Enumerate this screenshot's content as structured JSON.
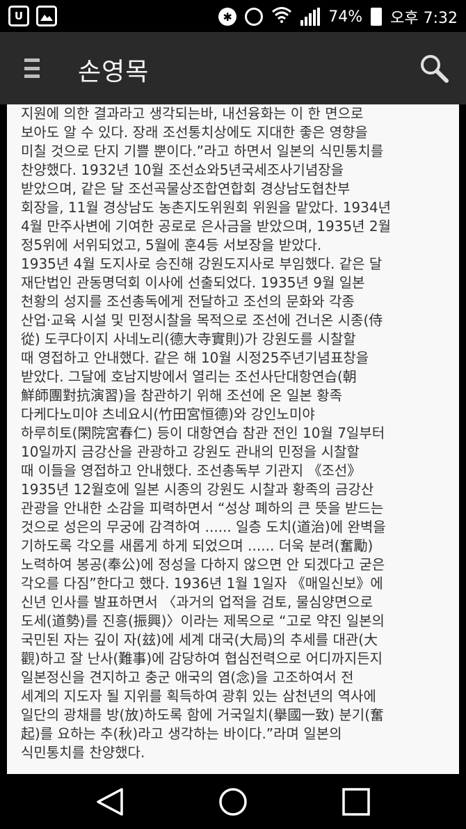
{
  "status_bar": {
    "left_icon_1": "U",
    "battery_percent": "74%",
    "time": "오후 7:32",
    "icons": [
      "uplus-icon",
      "image-icon",
      "bluetooth-icon",
      "alarm-icon",
      "wifi-icon",
      "signal-icon",
      "battery-icon"
    ]
  },
  "app_bar": {
    "title": "손영목"
  },
  "content": {
    "lines": [
      "지원에 의한 결과라고 생각되는바, 내선융화는 이 한 면으로",
      "보아도 알 수 있다. 장래 조선통치상에도 지대한 좋은 영향을",
      "미칠 것으로 단지 기쁠 뿐이다.”라고 하면서 일본의 식민통치를",
      "찬양했다. 1932년 10월 조선쇼와5년국세조사기념장을",
      "받았으며, 같은 달 조선곡물상조합연합회 경상남도협찬부",
      "회장을, 11월 경상남도 농촌지도위원회 위원을 맡았다. 1934년",
      "4월 만주사변에 기여한 공로로 은사금을 받았으며, 1935년 2월",
      "정5위에 서위되었고, 5월에 훈4등 서보장을 받았다.",
      "1935년 4월 도지사로 승진해 강원도지사로 부임했다. 같은 달",
      "재단법인 관동명덕회 이사에 선출되었다. 1935년 9월 일본",
      "천황의 성지를 조선총독에게 전달하고 조선의 문화와 각종",
      "산업·교육 시설 및 민정시찰을 목적으로 조선에 건너온 시종(侍",
      "從) 도쿠다이지 사네노리(德大寺實則)가 강원도를 시찰할",
      "때 영접하고 안내했다. 같은 해 10월 시정25주년기념표창을",
      "받았다. 그달에 호남지방에서 열리는 조선사단대항연습(朝",
      "鮮師團對抗演習)을 참관하기 위해 조선에 온 일본 황족",
      "다케다노미야 츠네요시(竹田宮恒德)와 강인노미야",
      "하루히토(閑院宮春仁) 등이 대항연습 참관 전인 10월 7일부터",
      "10일까지 금강산을 관광하고 강원도 관내의 민정을 시찰할",
      "때 이들을 영접하고 안내했다. 조선총독부 기관지 《조선》",
      "1935년 12월호에 일본 시종의 강원도 시찰과 황족의 금강산",
      "관광을 안내한 소감을 피력하면서 “성상 폐하의 큰 뜻을 받드는",
      "것으로 성은의 무궁에 감격하여 ...... 일층 도치(道治)에 완벽을",
      "기하도록 각오를 새롭게 하게 되었으며 ...... 더욱 분려(奮勵)",
      "노력하여 봉공(奉公)에 정성을 다하지 않으면 안 되겠다고 굳은",
      "각오를 다짐”한다고 했다. 1936년 1월 1일자 《매일신보》에",
      "신년 인사를 발표하면서 〈과거의 업적을 검토, 물심양면으로",
      "도세(道勢)를 진흥(振興)〉이라는 제목으로 “고로 약진 일본의",
      "국민된 자는 깊이 자(玆)에 세계 대국(大局)의 추세를 대관(大",
      "觀)하고 잘 난사(難事)에 감당하여 협심전력으로 어디까지든지",
      "일본정신을 견지하고 충군 애국의 염(念)을 고조하여서 전",
      "세계의 지도자 될 지위를 획득하여 광휘 있는 삼천년의 역사에",
      "일단의 광채를 방(放)하도록 함에 거국일치(擧國一致) 분기(奮",
      "起)를 요하는 추(秋)라고 생각하는 바이다.”라며 일본의",
      "식민통치를 찬양했다."
    ]
  },
  "nav_bar": {
    "buttons": [
      "back-icon",
      "home-icon",
      "recents-icon"
    ]
  }
}
